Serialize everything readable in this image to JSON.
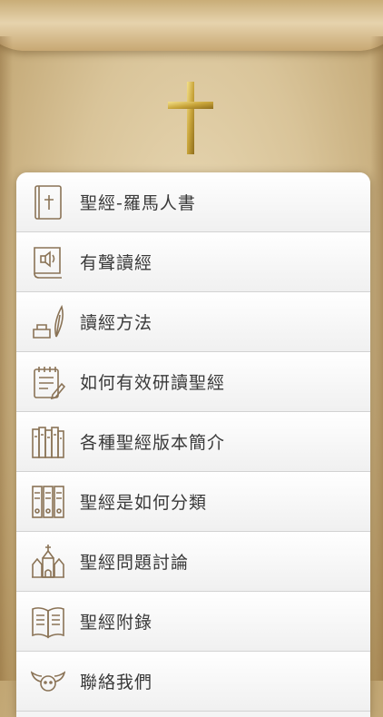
{
  "menu": {
    "items": [
      {
        "label": "聖經-羅馬人書",
        "icon": "bible-cross-icon"
      },
      {
        "label": "有聲讀經",
        "icon": "audio-book-icon"
      },
      {
        "label": "讀經方法",
        "icon": "ink-quill-icon"
      },
      {
        "label": "如何有效研讀聖經",
        "icon": "notepad-pencil-icon"
      },
      {
        "label": "各種聖經版本簡介",
        "icon": "bookshelf-icon"
      },
      {
        "label": "聖經是如何分類",
        "icon": "binders-icon"
      },
      {
        "label": "聖經問題討論",
        "icon": "church-icon"
      },
      {
        "label": "聖經附錄",
        "icon": "open-book-icon"
      },
      {
        "label": "聯絡我們",
        "icon": "winged-face-icon"
      }
    ]
  },
  "colors": {
    "parchment": "#d9c499",
    "cross_gold": "#c9a53a",
    "icon_stroke": "#8a7356",
    "label_text": "#3a3a3a"
  }
}
